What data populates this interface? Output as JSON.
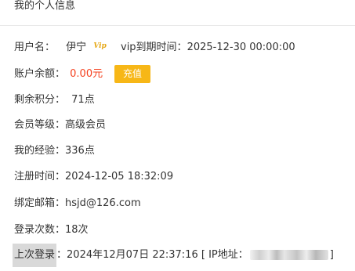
{
  "header": {
    "title": "我的个人信息"
  },
  "profile": {
    "username_label": "用户名：",
    "username": "伊宁",
    "vip_badge": "Vip",
    "vip_expire_label": "vip到期时间：",
    "vip_expire": "2025-12-30 00:00:00",
    "balance_label": "账户余额：",
    "balance": "0.00元",
    "recharge_label": "充值",
    "points_label": "剩余积分：",
    "points": "71点",
    "level_label": "会员等级：",
    "level": "高级会员",
    "exp_label": "我的经验：",
    "exp": "336点",
    "register_label": "注册时间：",
    "register_time": "2024-12-05 18:32:09",
    "email_label": "绑定邮箱：",
    "email": "hsjd@126.com",
    "login_count_label": "登录次数：",
    "login_count": "18次",
    "last_login_label": "上次登录",
    "last_login_sep": "：",
    "last_login_time": "2024年12月07日 22:37:16",
    "ip_prefix": "[ IP地址：",
    "ip_suffix": "]"
  },
  "colors": {
    "accent": "#f7b717",
    "balance": "#f5401e",
    "vip": "#e6a817"
  }
}
